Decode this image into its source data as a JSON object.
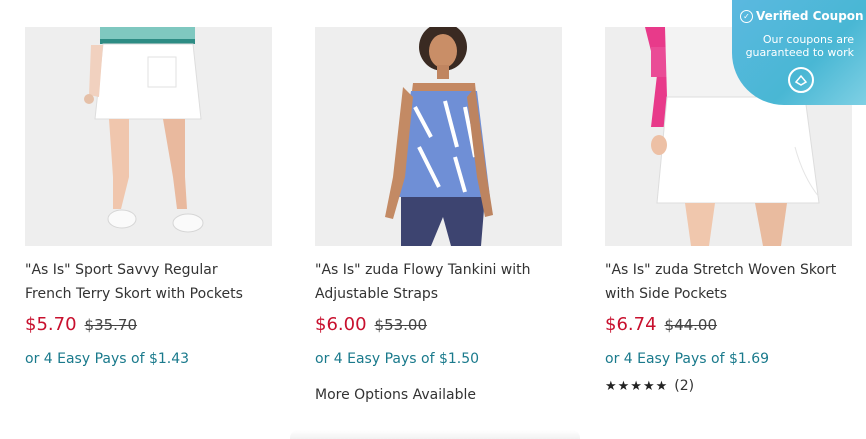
{
  "products": [
    {
      "title_line1": "\"As Is\" Sport Savvy Regular",
      "title_line2": "French Terry Skort with Pockets",
      "price": "$5.70",
      "was_price": "$35.70",
      "easy_pays": "or 4 Easy Pays of $1.43"
    },
    {
      "title_line1": "\"As Is\" zuda Flowy Tankini with",
      "title_line2": "Adjustable Straps",
      "price": "$6.00",
      "was_price": "$53.00",
      "easy_pays": "or 4 Easy Pays of $1.50",
      "more_options": "More Options Available"
    },
    {
      "title_line1": "\"As Is\" zuda Stretch Woven Skort",
      "title_line2": "with Side Pockets",
      "price": "$6.74",
      "was_price": "$44.00",
      "easy_pays": "or 4 Easy Pays of $1.69",
      "stars": "★★★★★",
      "review_count": "(2)"
    }
  ],
  "coupon": {
    "heading": "Verified Coupon",
    "subtext_line1": "Our coupons are",
    "subtext_line2": "guaranteed to work"
  },
  "colors": {
    "sale_price": "#c8102e",
    "easy_pays": "#1a7a8c",
    "coupon_bg": "#49b7d4"
  }
}
